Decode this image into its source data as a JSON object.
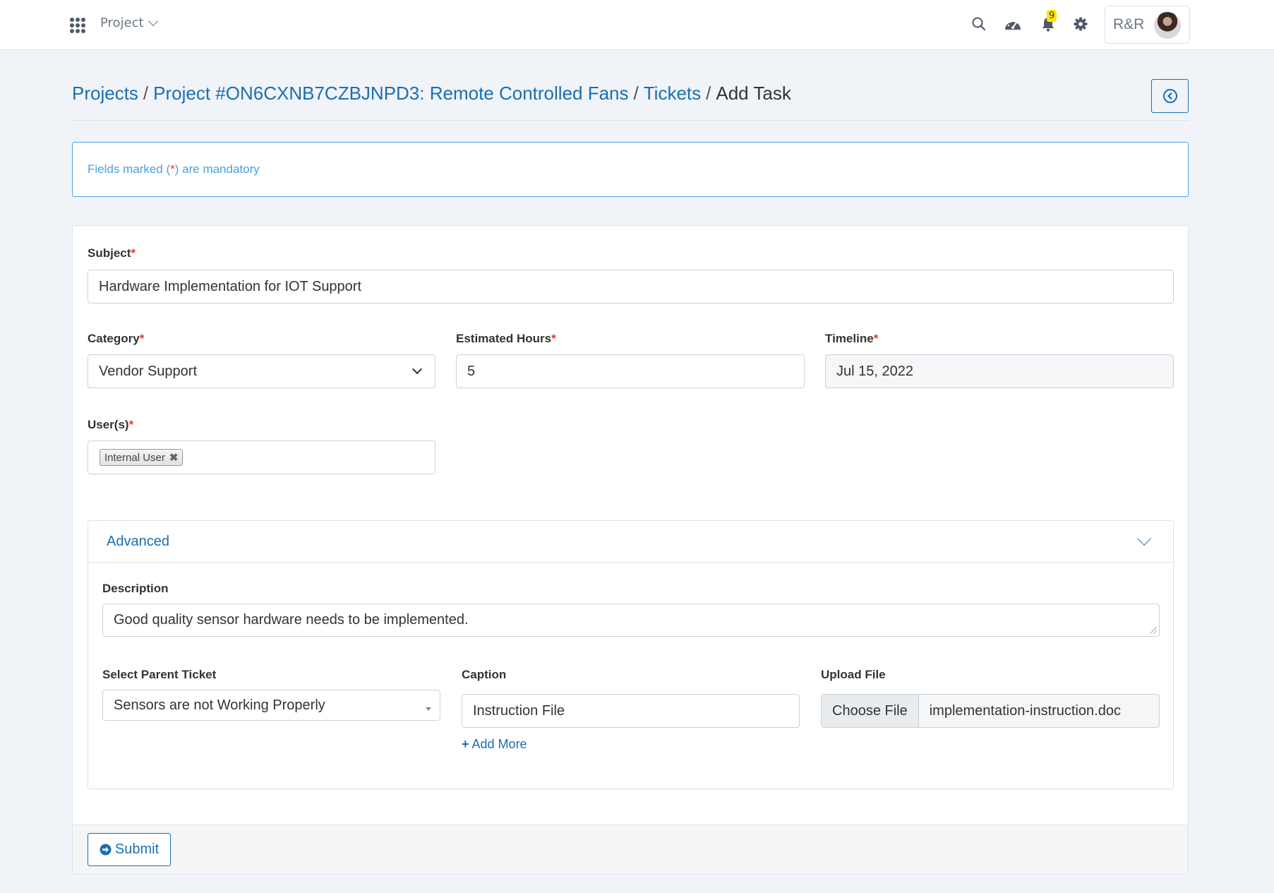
{
  "topbar": {
    "project_menu": "Project",
    "notification_count": "9",
    "user_initials": "R&R"
  },
  "breadcrumb": {
    "items": [
      "Projects",
      "Project #ON6CXNB7CZBJNPD3: Remote Controlled Fans",
      "Tickets"
    ],
    "separator": "/",
    "current": "Add Task"
  },
  "alert": {
    "prefix": "Fields marked (",
    "star": "*",
    "suffix": ") are mandatory"
  },
  "form": {
    "required_marker": "*",
    "subject": {
      "label": "Subject",
      "value": "Hardware Implementation for IOT Support"
    },
    "category": {
      "label": "Category",
      "value": "Vendor Support"
    },
    "estimated_hours": {
      "label": "Estimated Hours",
      "value": "5"
    },
    "timeline": {
      "label": "Timeline",
      "value": "Jul 15, 2022"
    },
    "users": {
      "label": "User(s)",
      "tags": [
        "Internal User"
      ],
      "remove_glyph": "✖"
    },
    "advanced": {
      "title": "Advanced",
      "description": {
        "label": "Description",
        "value": "Good quality sensor hardware needs to be implemented."
      },
      "parent_ticket": {
        "label": "Select Parent Ticket",
        "value": "Sensors are not Working Properly"
      },
      "caption": {
        "label": "Caption",
        "value": "Instruction File"
      },
      "add_more": "Add More",
      "upload": {
        "label": "Upload File",
        "button": "Choose File",
        "filename": "implementation-instruction.doc"
      }
    },
    "submit": "Submit"
  },
  "colors": {
    "accent": "#1a6fb0",
    "alert": "#4aa1e0",
    "required": "#e53935",
    "badge": "#ffe600"
  }
}
